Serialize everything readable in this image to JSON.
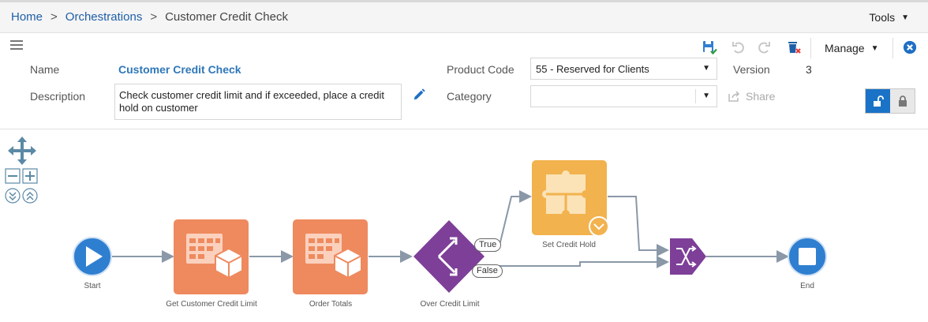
{
  "breadcrumb": {
    "home": "Home",
    "separator": ">",
    "orchestrations": "Orchestrations",
    "current": "Customer Credit Check"
  },
  "tools": {
    "label": "Tools"
  },
  "toolbar": {
    "manage_label": "Manage"
  },
  "form": {
    "name_label": "Name",
    "name_value": "Customer Credit Check",
    "description_label": "Description",
    "description_value": "Check customer credit limit and if exceeded, place a credit hold on customer",
    "product_code_label": "Product Code",
    "product_code_value": "55 - Reserved for Clients",
    "category_label": "Category",
    "category_value": "",
    "version_label": "Version",
    "version_value": "3",
    "share_label": "Share"
  },
  "flow": {
    "nodes": [
      {
        "id": "start",
        "label": "Start",
        "type": "start"
      },
      {
        "id": "get_credit_limit",
        "label": "Get Customer Credit Limit",
        "type": "data-request"
      },
      {
        "id": "order_totals",
        "label": "Order Totals",
        "type": "data-request"
      },
      {
        "id": "over_credit_limit",
        "label": "Over Credit Limit",
        "type": "rule"
      },
      {
        "id": "set_credit_hold",
        "label": "Set Credit Hold",
        "type": "custom"
      },
      {
        "id": "merge",
        "label": "",
        "type": "join"
      },
      {
        "id": "end",
        "label": "End",
        "type": "end"
      }
    ],
    "edge_labels": {
      "true": "True",
      "false": "False"
    }
  },
  "colors": {
    "link": "#1f5fa8",
    "accent_blue": "#2f7fd1",
    "data_request": "#ee8a5e",
    "custom_service": "#f2b24e",
    "rule": "#7d3f98",
    "connector": "#8a98a8"
  }
}
